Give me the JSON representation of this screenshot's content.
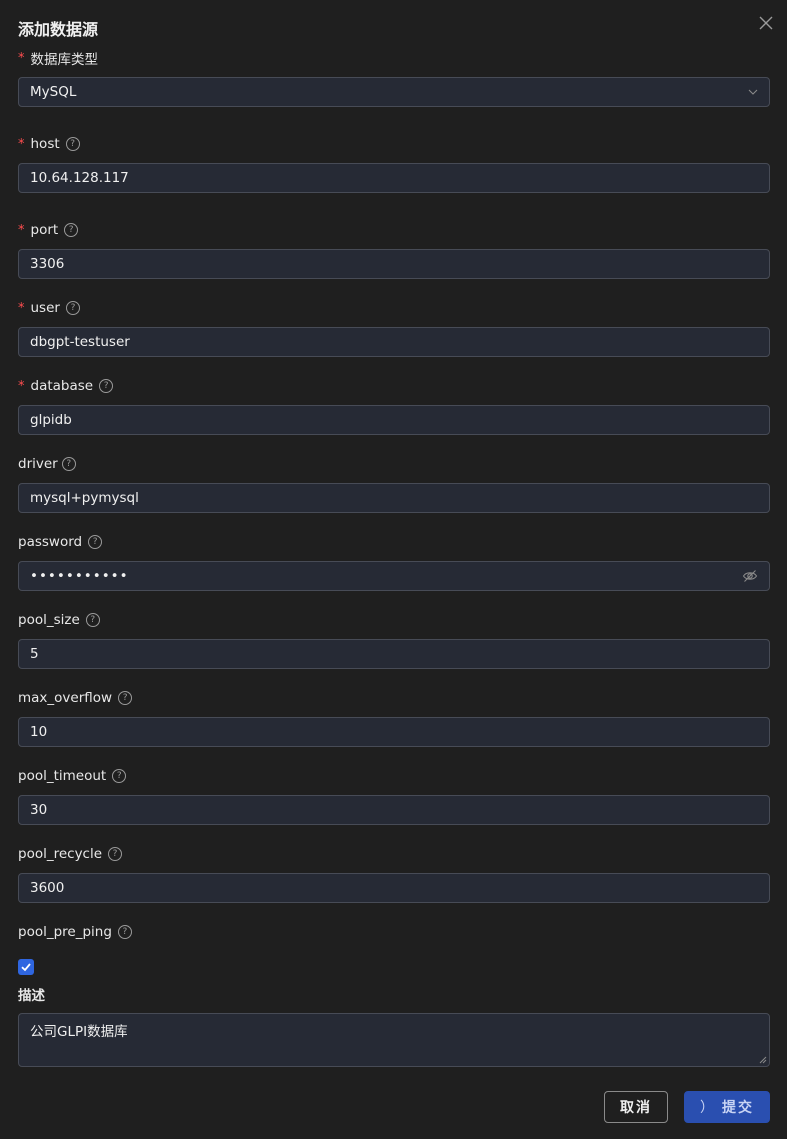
{
  "dialog": {
    "title": "添加数据源",
    "close_icon": "close-icon"
  },
  "fields": {
    "db_type": {
      "label": "数据库类型",
      "value": "MySQL"
    },
    "host": {
      "label": "host",
      "value": "10.64.128.117"
    },
    "port": {
      "label": "port",
      "value": "3306"
    },
    "user": {
      "label": "user",
      "value": "dbgpt-testuser"
    },
    "database": {
      "label": "database",
      "value": "glpidb"
    },
    "driver": {
      "label": "driver",
      "value": "mysql+pymysql"
    },
    "password": {
      "label": "password",
      "value": "•••••••••••"
    },
    "pool_size": {
      "label": "pool_size",
      "value": "5"
    },
    "max_overflow": {
      "label": "max_overflow",
      "value": "10"
    },
    "pool_timeout": {
      "label": "pool_timeout",
      "value": "30"
    },
    "pool_recycle": {
      "label": "pool_recycle",
      "value": "3600"
    },
    "pool_pre_ping": {
      "label": "pool_pre_ping",
      "checked": true
    },
    "description": {
      "label": "描述",
      "value": "公司GLPI数据库"
    }
  },
  "buttons": {
    "cancel": "取消",
    "submit": "提交",
    "submit_spinner": "）"
  },
  "help_glyph": "?",
  "required_mark": "*",
  "colors": {
    "accent": "#2f66e0",
    "required": "#ff4d4f",
    "background": "#1f1f1f",
    "input_bg": "#262a35"
  }
}
